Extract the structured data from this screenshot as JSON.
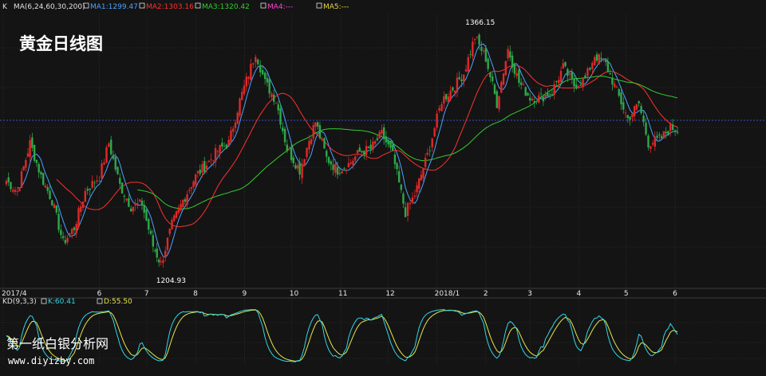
{
  "title": "黄金日线图",
  "indicator_bar": {
    "k_label": "K",
    "ma_label": "MA(6,24,60,30,200)",
    "items": [
      {
        "label": "MA1:1299.47",
        "color": "#4aa3ff"
      },
      {
        "label": "MA2:1303.16",
        "color": "#ff3030"
      },
      {
        "label": "MA3:1320.42",
        "color": "#33cc33"
      },
      {
        "label": "MA4:---",
        "color": "#ff44cc"
      },
      {
        "label": "MA5:---",
        "color": "#e6d84a"
      }
    ]
  },
  "kd_bar": {
    "label": "KD(9,3,3)",
    "items": [
      {
        "label": "K:60.41",
        "color": "#33d6e6"
      },
      {
        "label": "D:55.50",
        "color": "#e6e64a"
      }
    ]
  },
  "annotations": {
    "high": "1366.15",
    "low": "1204.93"
  },
  "watermark": {
    "line1": "第一纸白银分析网",
    "line2": "www.diyizby.com"
  },
  "colors": {
    "up": "#e02828",
    "down": "#2ea84a",
    "grid": "#3a3a3a",
    "dotted_line": "#3355cc"
  },
  "chart_data": {
    "type": "candlestick",
    "title": "黄金日线图",
    "x_tick_labels": [
      "2017/4",
      "6",
      "7",
      "8",
      "9",
      "10",
      "11",
      "12",
      "2018/1",
      "2",
      "3",
      "4",
      "5",
      "6"
    ],
    "price_ylim": [
      1195,
      1375
    ],
    "marked_high": 1366.15,
    "marked_low": 1204.93,
    "current_price_line": 1305,
    "waypoints": [
      [
        "2017-04-03",
        1265
      ],
      [
        "2017-04-10",
        1258
      ],
      [
        "2017-04-18",
        1290
      ],
      [
        "2017-04-25",
        1268
      ],
      [
        "2017-05-02",
        1252
      ],
      [
        "2017-05-09",
        1224
      ],
      [
        "2017-05-16",
        1234
      ],
      [
        "2017-05-23",
        1258
      ],
      [
        "2017-06-01",
        1268
      ],
      [
        "2017-06-07",
        1290
      ],
      [
        "2017-06-14",
        1262
      ],
      [
        "2017-06-21",
        1248
      ],
      [
        "2017-06-28",
        1250
      ],
      [
        "2017-07-05",
        1222
      ],
      [
        "2017-07-10",
        1210
      ],
      [
        "2017-07-17",
        1236
      ],
      [
        "2017-07-24",
        1252
      ],
      [
        "2017-08-01",
        1268
      ],
      [
        "2017-08-08",
        1276
      ],
      [
        "2017-08-15",
        1285
      ],
      [
        "2017-08-22",
        1290
      ],
      [
        "2017-08-29",
        1318
      ],
      [
        "2017-09-05",
        1340
      ],
      [
        "2017-09-08",
        1350
      ],
      [
        "2017-09-14",
        1330
      ],
      [
        "2017-09-21",
        1318
      ],
      [
        "2017-09-28",
        1286
      ],
      [
        "2017-10-06",
        1272
      ],
      [
        "2017-10-12",
        1292
      ],
      [
        "2017-10-16",
        1304
      ],
      [
        "2017-10-23",
        1280
      ],
      [
        "2017-10-30",
        1272
      ],
      [
        "2017-11-06",
        1276
      ],
      [
        "2017-11-13",
        1284
      ],
      [
        "2017-11-20",
        1286
      ],
      [
        "2017-11-27",
        1296
      ],
      [
        "2017-12-04",
        1282
      ],
      [
        "2017-12-12",
        1244
      ],
      [
        "2017-12-18",
        1256
      ],
      [
        "2017-12-26",
        1282
      ],
      [
        "2018-01-04",
        1318
      ],
      [
        "2018-01-11",
        1326
      ],
      [
        "2018-01-18",
        1336
      ],
      [
        "2018-01-25",
        1360
      ],
      [
        "2018-02-01",
        1346
      ],
      [
        "2018-02-08",
        1316
      ],
      [
        "2018-02-15",
        1352
      ],
      [
        "2018-02-22",
        1330
      ],
      [
        "2018-03-01",
        1320
      ],
      [
        "2018-03-08",
        1320
      ],
      [
        "2018-03-15",
        1324
      ],
      [
        "2018-03-22",
        1340
      ],
      [
        "2018-03-29",
        1328
      ],
      [
        "2018-04-05",
        1332
      ],
      [
        "2018-04-11",
        1348
      ],
      [
        "2018-04-18",
        1342
      ],
      [
        "2018-04-25",
        1324
      ],
      [
        "2018-05-02",
        1306
      ],
      [
        "2018-05-09",
        1316
      ],
      [
        "2018-05-15",
        1290
      ],
      [
        "2018-05-22",
        1292
      ],
      [
        "2018-05-29",
        1300
      ],
      [
        "2018-06-04",
        1298
      ]
    ],
    "moving_averages": [
      {
        "name": "MA1",
        "value": 1299.47,
        "period": 6,
        "color": "#4aa3ff"
      },
      {
        "name": "MA2",
        "value": 1303.16,
        "period": 24,
        "color": "#ff3030"
      },
      {
        "name": "MA3",
        "value": 1320.42,
        "period": 60,
        "color": "#33cc33"
      },
      {
        "name": "MA4",
        "value": null,
        "period": 30,
        "color": "#ff44cc"
      },
      {
        "name": "MA5",
        "value": null,
        "period": 200,
        "color": "#e6d84a"
      }
    ],
    "kd": {
      "k_last": 60.41,
      "d_last": 55.5,
      "params": [
        9,
        3,
        3
      ]
    }
  }
}
